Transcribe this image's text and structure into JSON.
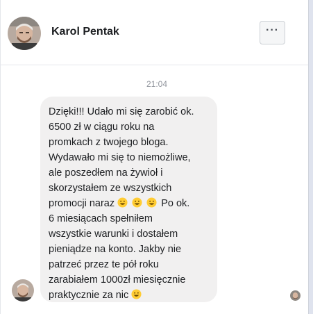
{
  "header": {
    "contact_name": "Karol Pentak",
    "avatar_icon": "contact-avatar",
    "more_icon": "more-options-icon",
    "more_label": "···"
  },
  "conversation": {
    "timestamp": "21:04",
    "message": {
      "lines": [
        "Dzięki!!! Udało mi się zarobić ok.",
        "6500 zł w ciągu roku na",
        "promkach z twojego bloga.",
        "Wydawało mi się to niemożliwe,",
        "ale poszedłem na żywioł i",
        "skorzystałem ze wszystkich",
        "promocji naraz",
        "Po ok.",
        "6 miesiącach spełniłem",
        "wszystkie warunki i dostałem",
        "pieniądze na konto. Jakby nie",
        "patrzeć przez te pół roku",
        "zarabiałem 1000zł miesięcznie",
        "praktycznie za nic"
      ],
      "emoji_icon": "grinning-face-emoji"
    }
  },
  "colors": {
    "bubble_bg": "#f1f0f0",
    "text": "#1c1e21",
    "muted": "#90949c",
    "emoji_face": "#ffcc33"
  }
}
